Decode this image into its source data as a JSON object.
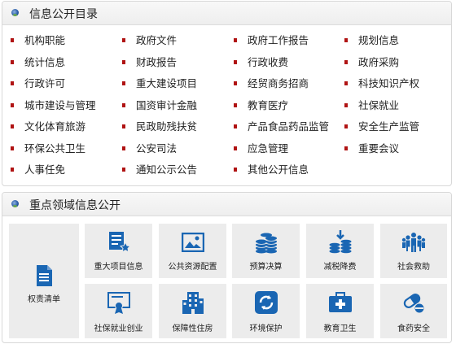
{
  "catalog": {
    "title": "信息公开目录",
    "items": [
      "机构职能",
      "政府文件",
      "政府工作报告",
      "规划信息",
      "统计信息",
      "财政报告",
      "行政收费",
      "政府采购",
      "行政许可",
      "重大建设项目",
      "经贸商务招商",
      "科技知识产权",
      "城市建设与管理",
      "国资审计金融",
      "教育医疗",
      "社保就业",
      "文化体育旅游",
      "民政助残扶贫",
      "产品食品药品监管",
      "安全生产监管",
      "环保公共卫生",
      "公安司法",
      "应急管理",
      "重要会议",
      "人事任免",
      "通知公示公告",
      "其他公开信息"
    ]
  },
  "focus": {
    "title": "重点领域信息公开",
    "large_tile": {
      "label": "权责清单",
      "icon": "document-icon"
    },
    "tiles": [
      {
        "label": "重大项目信息",
        "icon": "list-star-icon"
      },
      {
        "label": "公共资源配置",
        "icon": "picture-icon"
      },
      {
        "label": "预算决算",
        "icon": "coins-icon"
      },
      {
        "label": "减税降费",
        "icon": "coins-down-icon"
      },
      {
        "label": "社会救助",
        "icon": "people-icon"
      },
      {
        "label": "社保就业创业",
        "icon": "certificate-icon"
      },
      {
        "label": "保障性住房",
        "icon": "building-icon"
      },
      {
        "label": "环境保护",
        "icon": "recycle-icon"
      },
      {
        "label": "教育卫生",
        "icon": "medical-kit-icon"
      },
      {
        "label": "食药安全",
        "icon": "pill-icon"
      }
    ],
    "accent_color": "#1a66b3"
  }
}
